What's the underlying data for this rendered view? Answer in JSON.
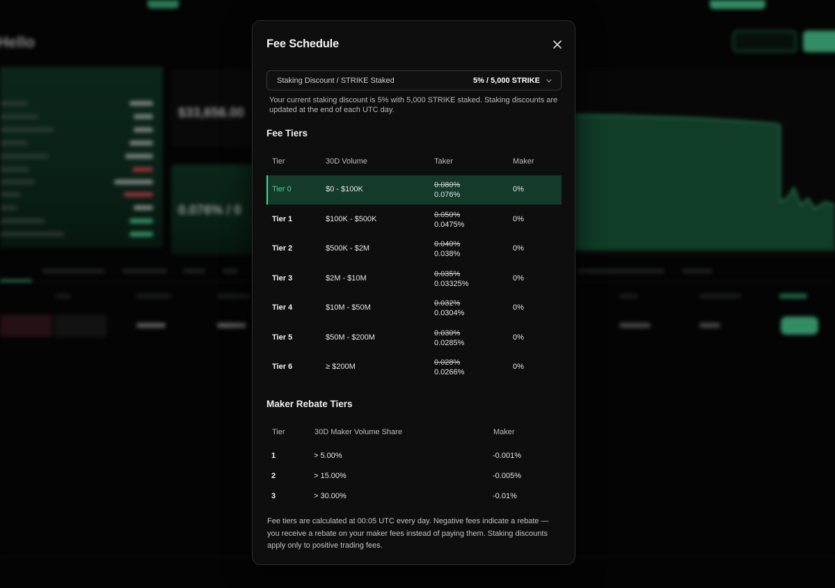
{
  "colors": {
    "accent": "#4dd89a",
    "active_row_bg": "#143a2a",
    "modal_bg": "#0e0e0e",
    "backdrop": "#070707"
  },
  "modal": {
    "title": "Fee Schedule",
    "close_icon": "close-icon",
    "staking": {
      "label": "Staking Discount / STRIKE Staked",
      "value": "5% / 5,000 STRIKE",
      "chevron_icon": "chevron-down-icon",
      "note": "Your current staking discount is 5% with 5,000 STRIKE staked. Staking discounts are updated at the end of each UTC day."
    },
    "fee_tiers": {
      "title": "Fee Tiers",
      "headers": [
        "Tier",
        "30D Volume",
        "Taker",
        "Maker"
      ],
      "rows": [
        {
          "tier": "Tier 0",
          "volume": "$0 - $100K",
          "taker_old": "0.080%",
          "taker_new": "0.076%",
          "maker": "0%",
          "active": true
        },
        {
          "tier": "Tier 1",
          "volume": "$100K - $500K",
          "taker_old": "0.050%",
          "taker_new": "0.0475%",
          "maker": "0%",
          "active": false
        },
        {
          "tier": "Tier 2",
          "volume": "$500K - $2M",
          "taker_old": "0.040%",
          "taker_new": "0.038%",
          "maker": "0%",
          "active": false
        },
        {
          "tier": "Tier 3",
          "volume": "$2M - $10M",
          "taker_old": "0.035%",
          "taker_new": "0.03325%",
          "maker": "0%",
          "active": false
        },
        {
          "tier": "Tier 4",
          "volume": "$10M - $50M",
          "taker_old": "0.032%",
          "taker_new": "0.0304%",
          "maker": "0%",
          "active": false
        },
        {
          "tier": "Tier 5",
          "volume": "$50M - $200M",
          "taker_old": "0.030%",
          "taker_new": "0.0285%",
          "maker": "0%",
          "active": false
        },
        {
          "tier": "Tier 6",
          "volume": "≥ $200M",
          "taker_old": "0.028%",
          "taker_new": "0.0266%",
          "maker": "0%",
          "active": false
        }
      ]
    },
    "rebate_tiers": {
      "title": "Maker Rebate Tiers",
      "headers": [
        "Tier",
        "30D Maker Volume Share",
        "Maker"
      ],
      "rows": [
        {
          "tier": "1",
          "share": "> 5.00%",
          "maker": "-0.001%"
        },
        {
          "tier": "2",
          "share": "> 15.00%",
          "maker": "-0.005%"
        },
        {
          "tier": "3",
          "share": "> 30.00%",
          "maker": "-0.01%"
        }
      ]
    },
    "footer_note": "Fee tiers are calculated at 00:05 UTC every day. Negative fees indicate a rebate — you receive a rebate on your maker fees instead of paying them. Staking discounts apply only to positive trading fees."
  },
  "background": {
    "page_title": "Hello",
    "volume_value": "$33,656.00",
    "fee_rate_value": "0.076% / 0"
  }
}
